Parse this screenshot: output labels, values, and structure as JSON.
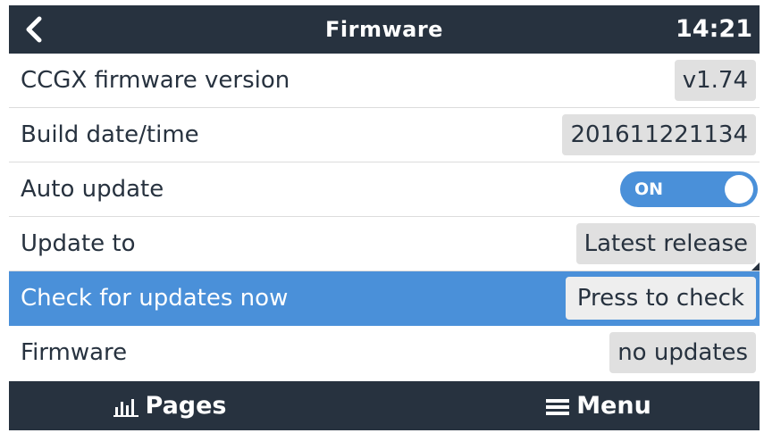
{
  "header": {
    "title": "Firmware",
    "clock": "14:21",
    "back_icon": "chevron-left-icon"
  },
  "rows": [
    {
      "label": "CCGX firmware version",
      "value": "v1.74"
    },
    {
      "label": "Build date/time",
      "value": "201611221134"
    },
    {
      "label": "Auto update",
      "toggle_text": "ON",
      "toggle_on": true
    },
    {
      "label": "Update to",
      "value": "Latest release"
    },
    {
      "label": "Check for updates now",
      "value": "Press to check",
      "selected": true
    },
    {
      "label": "Firmware",
      "value": "no updates"
    }
  ],
  "footer": {
    "pages_label": "Pages",
    "pages_icon": "bar-chart-icon",
    "menu_label": "Menu",
    "menu_icon": "hamburger-icon"
  },
  "colors": {
    "header_bg": "#27323f",
    "accent": "#4a90d9",
    "value_box_bg": "#e0e0e0"
  }
}
